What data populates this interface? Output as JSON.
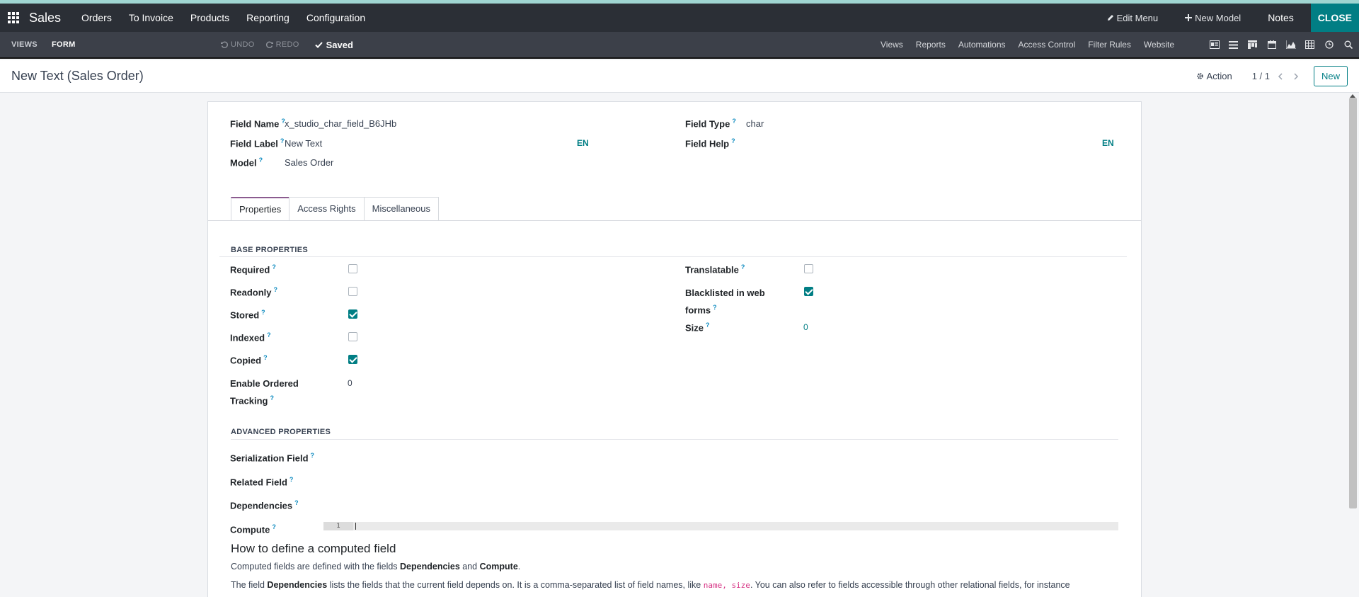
{
  "navbar": {
    "app_name": "Sales",
    "menu": [
      "Orders",
      "To Invoice",
      "Products",
      "Reporting",
      "Configuration"
    ],
    "edit_menu": "Edit Menu",
    "new_model": "New Model",
    "notes": "Notes",
    "close": "CLOSE"
  },
  "studio_bar": {
    "views_tab": "VIEWS",
    "form_tab": "FORM",
    "undo": "UNDO",
    "redo": "REDO",
    "saved": "Saved",
    "links": [
      "Views",
      "Reports",
      "Automations",
      "Access Control",
      "Filter Rules",
      "Website"
    ]
  },
  "control_panel": {
    "title": "New Text (Sales Order)",
    "action": "Action",
    "pager": "1 / 1",
    "new_button": "New"
  },
  "form": {
    "field_name_label": "Field Name",
    "field_name_value": "x_studio_char_field_B6JHb",
    "field_label_label": "Field Label",
    "field_label_value": "New Text",
    "lang": "EN",
    "model_label": "Model",
    "model_value": "Sales Order",
    "field_type_label": "Field Type",
    "field_type_value": "char",
    "field_help_label": "Field Help",
    "tabs": [
      "Properties",
      "Access Rights",
      "Miscellaneous"
    ],
    "base_properties_title": "BASE PROPERTIES",
    "required": "Required",
    "readonly": "Readonly",
    "stored": "Stored",
    "indexed": "Indexed",
    "copied": "Copied",
    "ordered_tracking_line1": "Enable Ordered",
    "ordered_tracking_line2": "Tracking",
    "ordered_tracking_value": "0",
    "translatable": "Translatable",
    "blacklisted_line1": "Blacklisted in web",
    "blacklisted_line2": "forms",
    "size": "Size",
    "size_value": "0",
    "checkboxes": {
      "required": false,
      "readonly": false,
      "stored": true,
      "indexed": false,
      "copied": true,
      "translatable": false,
      "blacklisted": true
    },
    "advanced_properties_title": "ADVANCED PROPERTIES",
    "serialization_field": "Serialization Field",
    "related_field": "Related Field",
    "dependencies": "Dependencies",
    "compute": "Compute",
    "code_line_number": "1",
    "help_title": "How to define a computed field",
    "help_p1_a": "Computed fields are defined with the fields ",
    "help_p1_b": "Dependencies",
    "help_p1_c": " and ",
    "help_p1_d": "Compute",
    "help_p1_e": ".",
    "help_p2_a": "The field ",
    "help_p2_b": "Dependencies",
    "help_p2_c": " lists the fields that the current field depends on. It is a comma-separated list of field names, like ",
    "help_p2_code": "name, size",
    "help_p2_d": ". You can also refer to fields accessible through other relational fields, for instance"
  }
}
